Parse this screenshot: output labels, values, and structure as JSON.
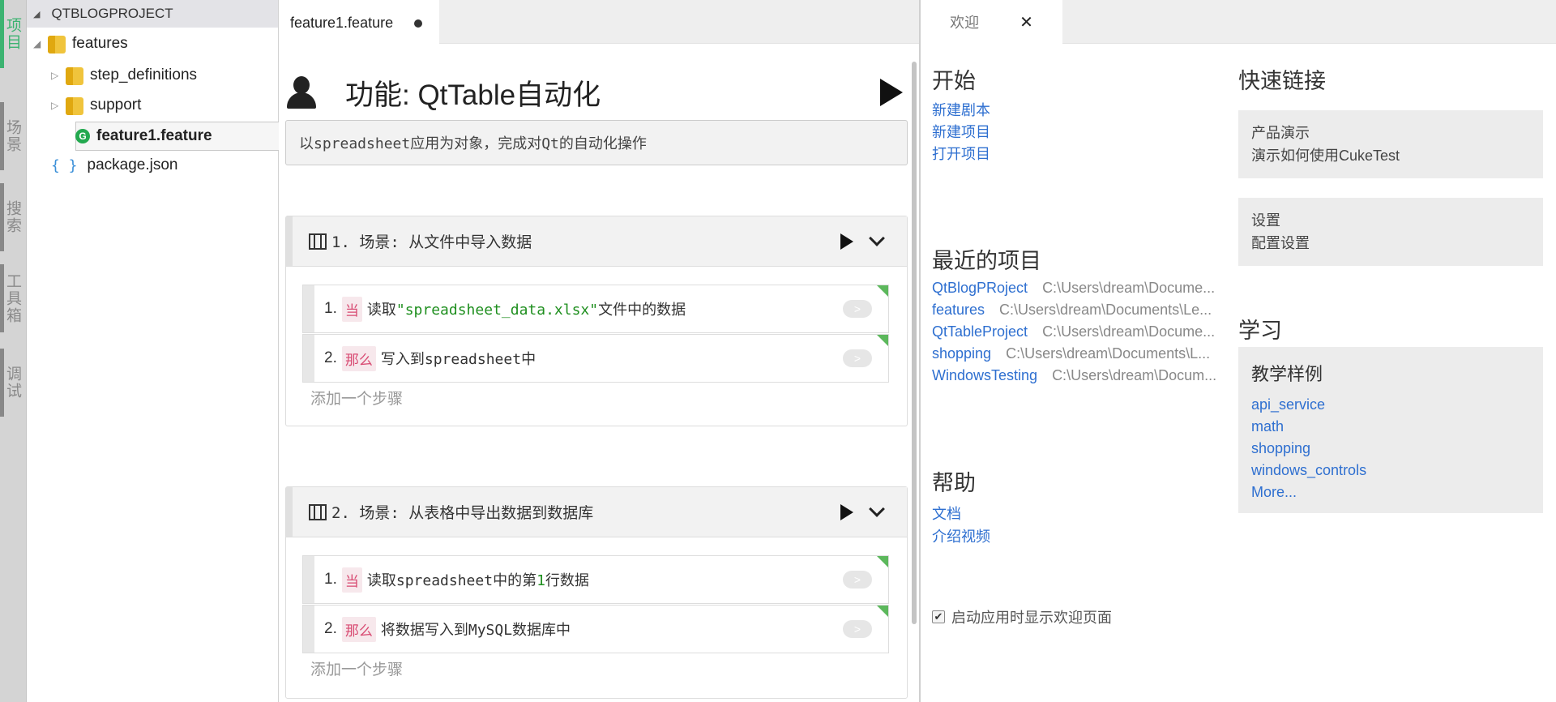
{
  "activity_bar": {
    "items": [
      {
        "label": "项目"
      },
      {
        "label": "场景"
      },
      {
        "label": "搜索"
      },
      {
        "label": "工具箱"
      },
      {
        "label": "调试"
      }
    ]
  },
  "explorer": {
    "title": "QTBLOGPROJECT",
    "items": [
      {
        "label": "features"
      },
      {
        "label": "step_definitions"
      },
      {
        "label": "support"
      },
      {
        "label": "feature1.feature"
      },
      {
        "label": "package.json"
      }
    ],
    "icons": {
      "json": "{ }",
      "gherkin": "G"
    }
  },
  "editor": {
    "tab_label": "feature1.feature",
    "feature_title": "功能: QtTable自动化",
    "description": "以spreadsheet应用为对象，完成对Qt的自动化操作",
    "add_step": "添加一个步骤",
    "scenarios": [
      {
        "title": "1. 场景: 从文件中导入数据",
        "steps": [
          {
            "num": "1.",
            "keyword": "当",
            "pre": "读取",
            "str": "\"spreadsheet_data.xlsx\"",
            "post": "文件中的数据",
            "pill": ">"
          },
          {
            "num": "2.",
            "keyword": "那么",
            "pre": "写入到spreadsheet中",
            "pill": ">"
          }
        ]
      },
      {
        "title": "2. 场景: 从表格中导出数据到数据库",
        "steps": [
          {
            "num": "1.",
            "keyword": "当",
            "pre": "读取spreadsheet中的第",
            "numval": "1",
            "post": "行数据",
            "pill": ">"
          },
          {
            "num": "2.",
            "keyword": "那么",
            "pre": "将数据写入到MySQL数据库中",
            "pill": ">"
          }
        ]
      }
    ]
  },
  "welcome": {
    "tab_label": "欢迎",
    "close_glyph": "✕",
    "start": {
      "heading": "开始",
      "links": [
        "新建剧本",
        "新建项目",
        "打开项目"
      ]
    },
    "recent": {
      "heading": "最近的项目",
      "items": [
        {
          "name": "QtBlogPRoject",
          "path": "C:\\Users\\dream\\Docume..."
        },
        {
          "name": "features",
          "path": "C:\\Users\\dream\\Documents\\Le..."
        },
        {
          "name": "QtTableProject",
          "path": "C:\\Users\\dream\\Docume..."
        },
        {
          "name": "shopping",
          "path": "C:\\Users\\dream\\Documents\\L..."
        },
        {
          "name": "WindowsTesting",
          "path": "C:\\Users\\dream\\Docum..."
        }
      ]
    },
    "help": {
      "heading": "帮助",
      "links": [
        "文档",
        "介绍视频"
      ]
    },
    "quick": {
      "heading": "快速链接",
      "boxes": [
        {
          "title": "产品演示",
          "desc": "演示如何使用CukeTest"
        },
        {
          "title": "设置",
          "desc": "配置设置"
        }
      ]
    },
    "learn": {
      "heading": "学习",
      "box_title": "教学样例",
      "links": [
        "api_service",
        "math",
        "shopping",
        "windows_controls",
        "More..."
      ]
    },
    "startup_label": "启动应用时显示欢迎页面",
    "startup_checked": true
  },
  "colors": {
    "accent_green": "#3cb371",
    "link_blue": "#2e6fd0",
    "keyword_red": "#d84a72",
    "string_green": "#1f8f1f"
  }
}
